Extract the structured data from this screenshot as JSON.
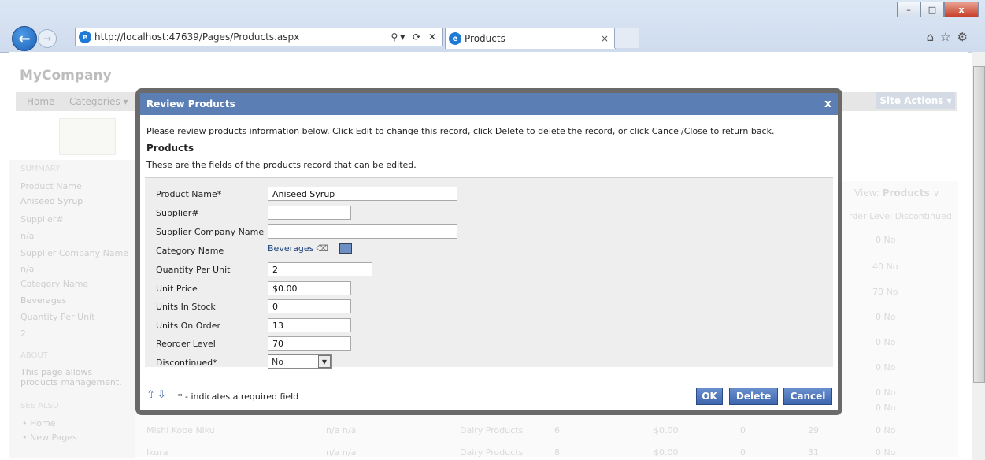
{
  "browser": {
    "address": "http://localhost:47639/Pages/Products.aspx",
    "address_host": "localhost",
    "tab_title": "Products",
    "tab_close": "×",
    "window_buttons": [
      "–",
      "□",
      "x"
    ]
  },
  "app": {
    "logo": "MyCompany",
    "menu": [
      "Home",
      "Categories ▾"
    ],
    "site_actions": "Site Actions ▾"
  },
  "sidebar": {
    "summary_header": "SUMMARY",
    "items": [
      {
        "label": "Product Name",
        "value": "Aniseed Syrup"
      },
      {
        "label": "Supplier#",
        "value": "n/a"
      },
      {
        "label": "Supplier Company Name",
        "value": "n/a"
      },
      {
        "label": "Category Name",
        "value": "Beverages"
      },
      {
        "label": "Quantity Per Unit",
        "value": "2"
      }
    ],
    "about_header": "ABOUT",
    "about_text": "This page allows products management.",
    "see_also_header": "SEE ALSO",
    "links": [
      "Home",
      "New Pages"
    ]
  },
  "background_grid": {
    "view_label": "View:",
    "view_value": "Products",
    "col_headers": "rder Level  Discontinued",
    "rows": [
      {
        "reorder": "0",
        "disc": "No"
      },
      {
        "reorder": "40",
        "disc": "No"
      },
      {
        "reorder": "70",
        "disc": "No"
      },
      {
        "reorder": "0",
        "disc": "No"
      },
      {
        "reorder": "0",
        "disc": "No"
      },
      {
        "reorder": "0",
        "disc": "No"
      },
      {
        "reorder": "0",
        "disc": "No"
      },
      {
        "reorder": "0",
        "disc": "No"
      }
    ],
    "row_mishi": {
      "name": "Mishi Kobe Niku",
      "sup": "n/a  n/a",
      "cat": "Dairy Products",
      "qty": "6",
      "price": "$0.00",
      "stock": "0",
      "order": "29",
      "reorder": "0",
      "disc": "No"
    },
    "row_ikura": {
      "name": "Ikura",
      "sup": "n/a  n/a",
      "cat": "Dairy Products",
      "qty": "8",
      "price": "$0.00",
      "stock": "0",
      "order": "31",
      "reorder": "0",
      "disc": "No"
    }
  },
  "dialog": {
    "title": "Review Products",
    "close": "x",
    "description": "Please review products information below. Click Edit to change this record, click Delete to delete the record, or click Cancel/Close to return back.",
    "section_title": "Products",
    "section_description": "These are the fields of the products record that can be edited.",
    "fields": {
      "product_name": {
        "label": "Product Name*",
        "value": "Aniseed Syrup"
      },
      "supplier_id": {
        "label": "Supplier#",
        "value": ""
      },
      "supplier_company": {
        "label": "Supplier Company Name",
        "value": ""
      },
      "category_name": {
        "label": "Category Name",
        "value": "Beverages"
      },
      "quantity_per_unit": {
        "label": "Quantity Per Unit",
        "value": "2"
      },
      "unit_price": {
        "label": "Unit Price",
        "value": "$0.00"
      },
      "units_in_stock": {
        "label": "Units In Stock",
        "value": "0"
      },
      "units_on_order": {
        "label": "Units On Order",
        "value": "13"
      },
      "reorder_level": {
        "label": "Reorder Level",
        "value": "70"
      },
      "discontinued": {
        "label": "Discontinued*",
        "value": "No"
      }
    },
    "required_note": "* - indicates a required field",
    "buttons": {
      "ok": "OK",
      "delete": "Delete",
      "cancel": "Cancel"
    }
  }
}
